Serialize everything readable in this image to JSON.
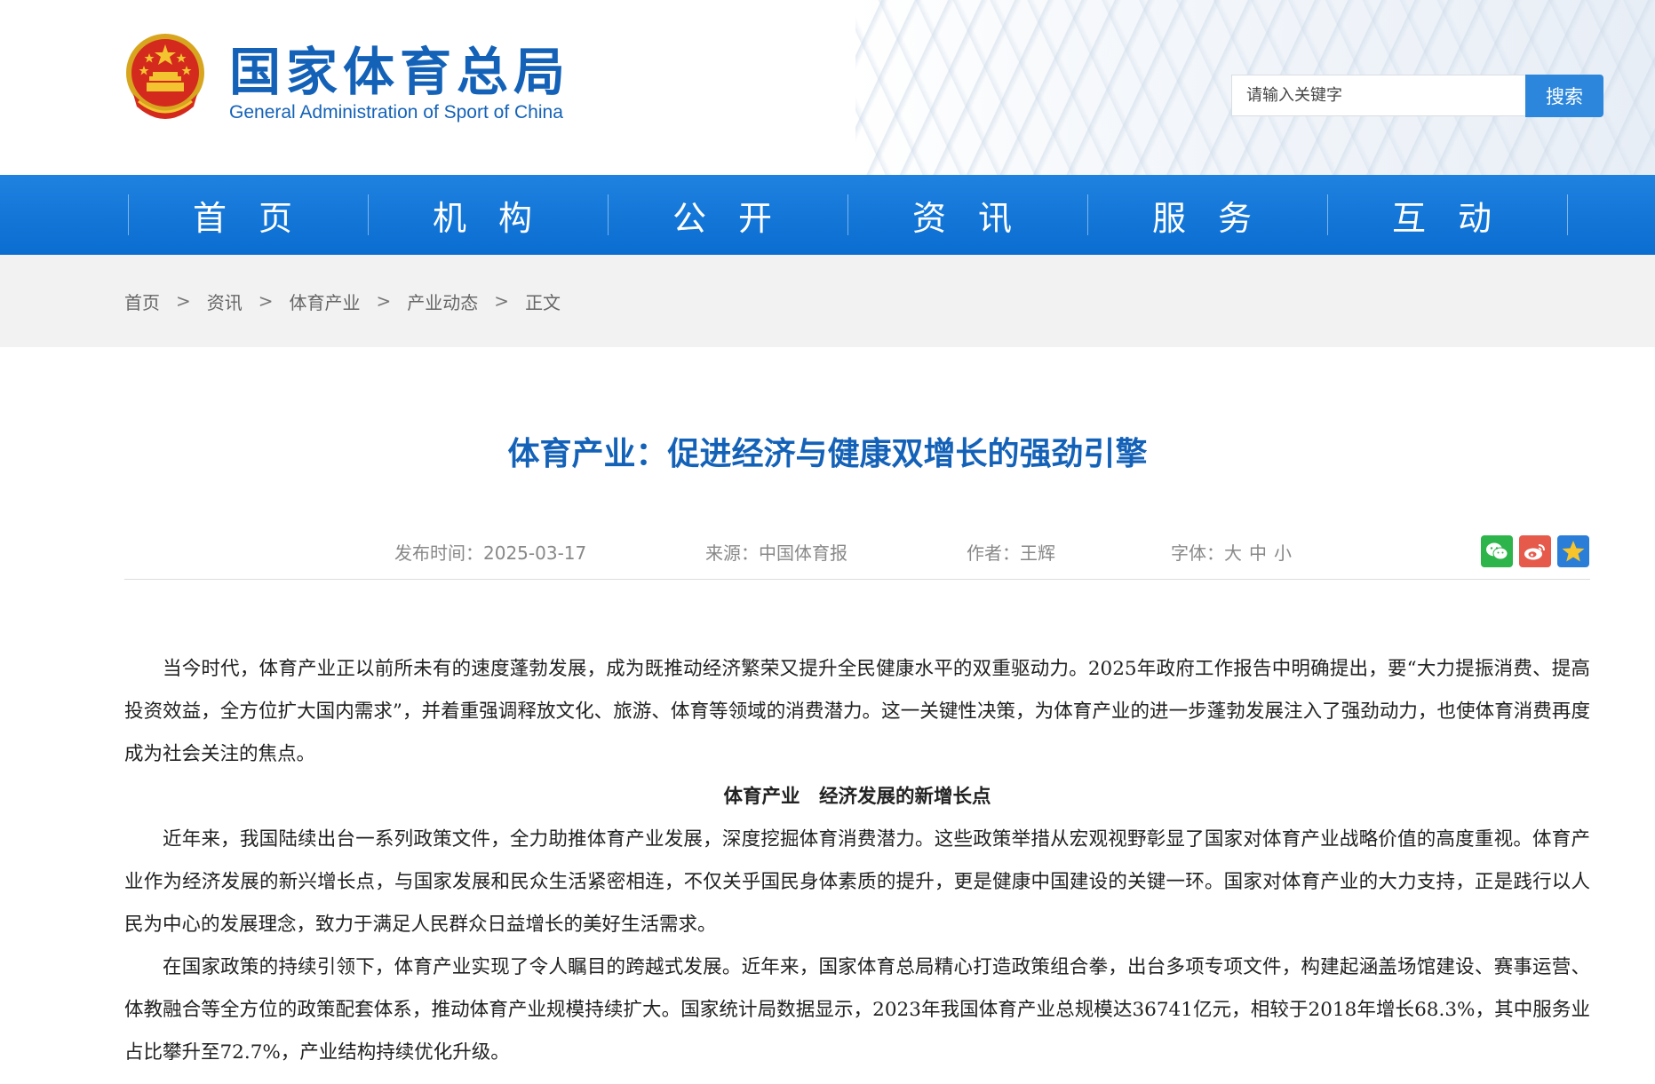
{
  "header": {
    "site_title": "国家体育总局",
    "site_subtitle": "General Administration of Sport of China",
    "search_placeholder": "请输入关键字",
    "search_button": "搜索"
  },
  "nav": {
    "items": [
      {
        "label": "首 页"
      },
      {
        "label": "机 构"
      },
      {
        "label": "公 开"
      },
      {
        "label": "资 讯"
      },
      {
        "label": "服 务"
      },
      {
        "label": "互 动"
      }
    ]
  },
  "breadcrumb": {
    "items": [
      "首页",
      "资讯",
      "体育产业",
      "产业动态"
    ],
    "separator": ">",
    "current": "正文"
  },
  "article": {
    "title": "体育产业：促进经济与健康双增长的强劲引擎",
    "publish_time": "发布时间：2025-03-17",
    "source": "来源：中国体育报",
    "author": "作者：王辉",
    "font_size_label": "字体：",
    "font_sizes": [
      "大",
      "中",
      "小"
    ],
    "share_icons": [
      "wechat-icon",
      "weibo-icon",
      "qzone-icon"
    ],
    "paragraph_1": "当今时代，体育产业正以前所未有的速度蓬勃发展，成为既推动经济繁荣又提升全民健康水平的双重驱动力。2025年政府工作报告中明确提出，要“大力提振消费、提高投资效益，全方位扩大国内需求”，并着重强调释放文化、旅游、体育等领域的消费潜力。这一关键性决策，为体育产业的进一步蓬勃发展注入了强劲动力，也使体育消费再度成为社会关注的焦点。",
    "subheading_1": "体育产业　经济发展的新增长点",
    "paragraph_2": "近年来，我国陆续出台一系列政策文件，全力助推体育产业发展，深度挖掘体育消费潜力。这些政策举措从宏观视野彰显了国家对体育产业战略价值的高度重视。体育产业作为经济发展的新兴增长点，与国家发展和民众生活紧密相连，不仅关乎国民身体素质的提升，更是健康中国建设的关键一环。国家对体育产业的大力支持，正是践行以人民为中心的发展理念，致力于满足人民群众日益增长的美好生活需求。",
    "paragraph_3": "在国家政策的持续引领下，体育产业实现了令人瞩目的跨越式发展。近年来，国家体育总局精心打造政策组合拳，出台多项专项文件，构建起涵盖场馆建设、赛事运营、体教融合等全方位的政策配套体系，推动体育产业规模持续扩大。国家统计局数据显示，2023年我国体育产业总规模达36741亿元，相较于2018年增长68.3%，其中服务业占比攀升至72.7%，产业结构持续优化升级。"
  },
  "colors": {
    "brand_blue": "#1462b8",
    "nav_blue": "#0a6dd0",
    "search_button": "#2b86dc"
  }
}
